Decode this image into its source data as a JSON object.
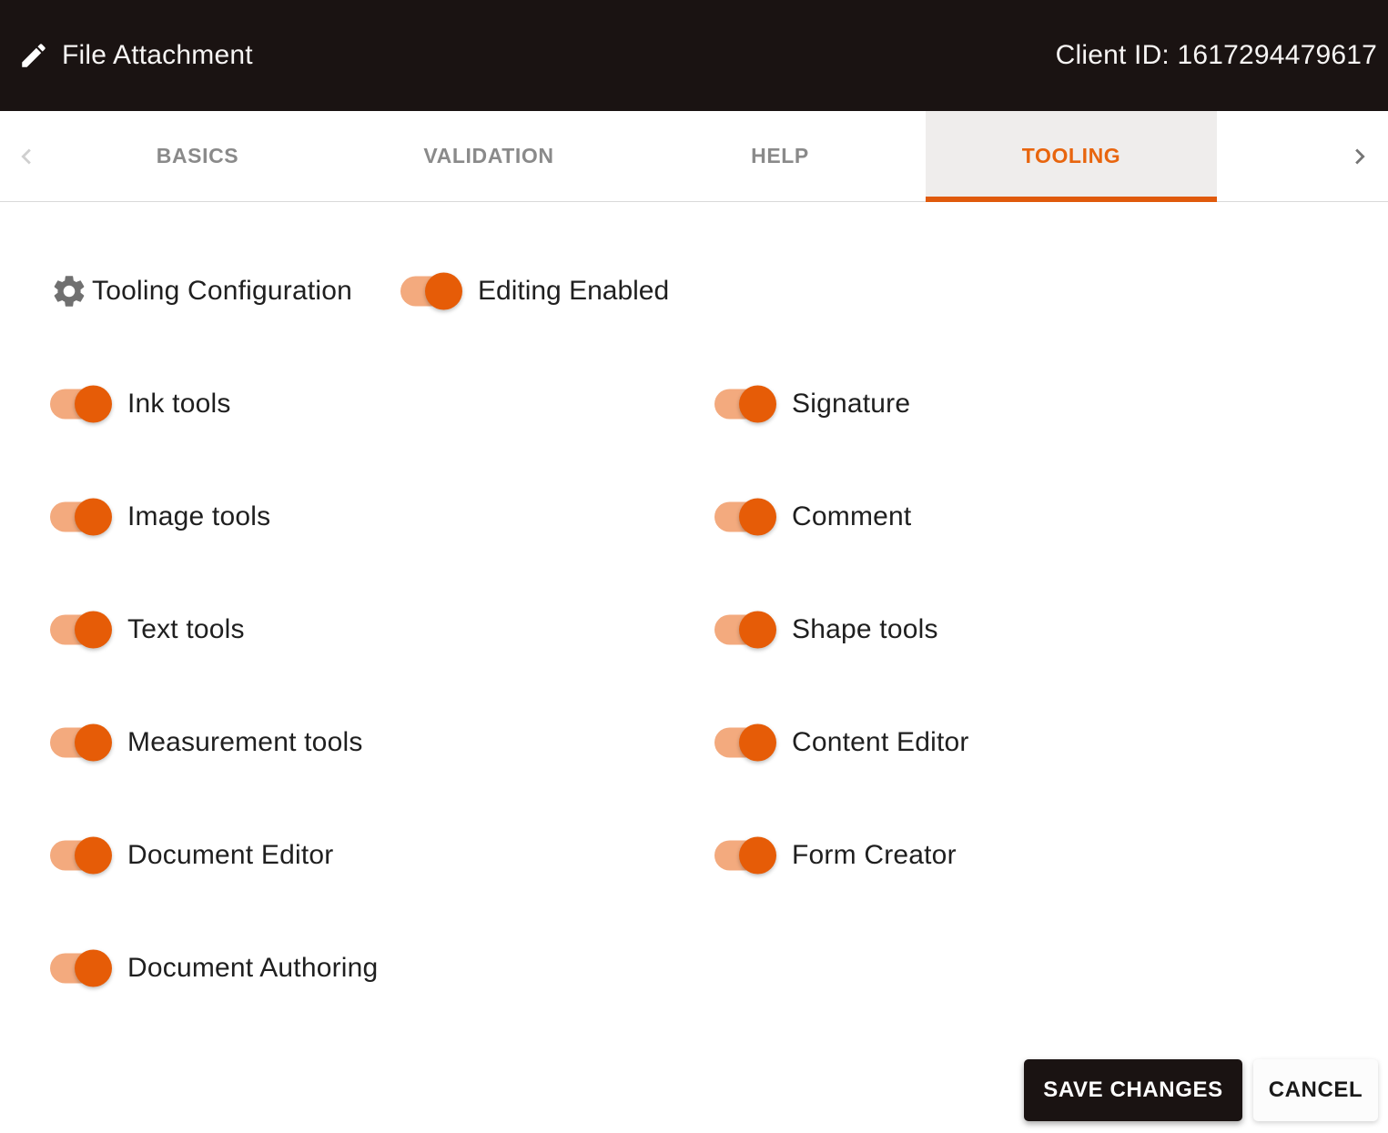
{
  "header": {
    "title": "File Attachment",
    "client_id": "Client ID: 1617294479617"
  },
  "tabs": {
    "basics": "BASICS",
    "validation": "VALIDATION",
    "help": "HELP",
    "tooling": "TOOLING",
    "active_tab": "TOOLING"
  },
  "section": {
    "title": "Tooling Configuration",
    "editing_toggle_label": "Editing Enabled",
    "editing_toggle_on": true
  },
  "toggles": {
    "left": [
      {
        "label": "Ink tools",
        "on": true
      },
      {
        "label": "Image tools",
        "on": true
      },
      {
        "label": "Text tools",
        "on": true
      },
      {
        "label": "Measurement tools",
        "on": true
      },
      {
        "label": "Document Editor",
        "on": true
      },
      {
        "label": "Document Authoring",
        "on": true
      }
    ],
    "right": [
      {
        "label": "Signature",
        "on": true
      },
      {
        "label": "Comment",
        "on": true
      },
      {
        "label": "Shape tools",
        "on": true
      },
      {
        "label": "Content Editor",
        "on": true
      },
      {
        "label": "Form Creator",
        "on": true
      }
    ]
  },
  "footer": {
    "save_label": "SAVE CHANGES",
    "cancel_label": "CANCEL"
  },
  "icons": {
    "header_icon": "pencil-icon",
    "section_icon": "gear-icon",
    "tab_prev": "chevron-left-icon",
    "tab_next": "chevron-right-icon"
  },
  "colors": {
    "header_bg": "#1a1312",
    "accent_orange": "#e65c07",
    "switch_track": "#f3aa7e",
    "tab_active_text": "#e8650e",
    "tab_underline": "#e05a0c",
    "tab_active_bg": "#efedec"
  }
}
